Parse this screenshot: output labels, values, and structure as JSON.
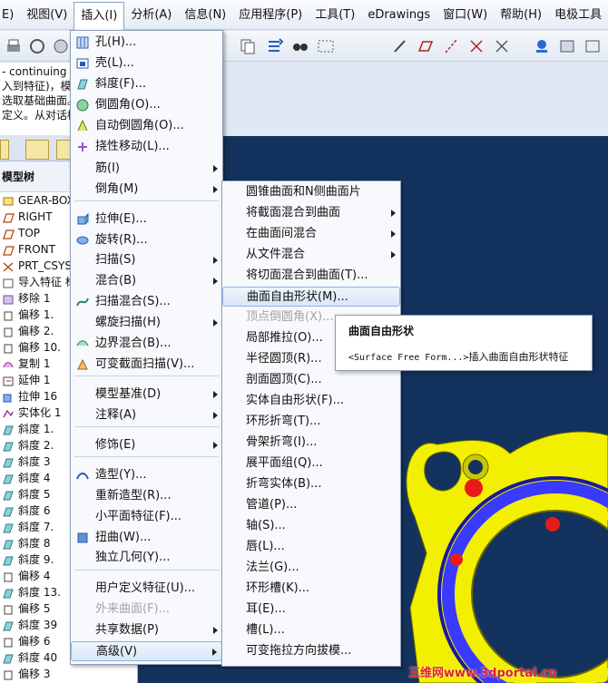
{
  "menubar": {
    "items": [
      {
        "label": "E)"
      },
      {
        "label": "视图(V)"
      },
      {
        "label": "插入(I)"
      },
      {
        "label": "分析(A)"
      },
      {
        "label": "信息(N)"
      },
      {
        "label": "应用程序(P)"
      },
      {
        "label": "工具(T)"
      },
      {
        "label": "eDrawings"
      },
      {
        "label": "窗口(W)"
      },
      {
        "label": "帮助(H)"
      },
      {
        "label": "电极工具"
      }
    ]
  },
  "message_area": {
    "lines": [
      "- continuing fro",
      "入到特征)，模型",
      "选取基础曲面。",
      "定义。从对话框"
    ]
  },
  "model_tree": {
    "header": "模型树",
    "items": [
      {
        "label": "GEAR-BOX.PRT",
        "icon": "part-icon"
      },
      {
        "label": "RIGHT",
        "icon": "datum-plane-icon"
      },
      {
        "label": "TOP",
        "icon": "datum-plane-icon"
      },
      {
        "label": "FRONT",
        "icon": "datum-plane-icon"
      },
      {
        "label": "PRT_CSYS_",
        "icon": "csys-icon"
      },
      {
        "label": "导入特征 标",
        "icon": "import-icon"
      },
      {
        "label": "移除 1",
        "icon": "remove-icon"
      },
      {
        "label": "偏移 1.",
        "icon": "offset-icon"
      },
      {
        "label": "偏移 2.",
        "icon": "offset-icon"
      },
      {
        "label": "偏移 10.",
        "icon": "offset-icon"
      },
      {
        "label": "复制 1",
        "icon": "copy-icon"
      },
      {
        "label": "延伸 1",
        "icon": "extend-icon"
      },
      {
        "label": "拉伸 16",
        "icon": "extrude-icon"
      },
      {
        "label": "实体化 1",
        "icon": "solidify-icon"
      },
      {
        "label": "斜度 1.",
        "icon": "draft-icon"
      },
      {
        "label": "斜度 2.",
        "icon": "draft-icon"
      },
      {
        "label": "斜度 3",
        "icon": "draft-icon"
      },
      {
        "label": "斜度 4",
        "icon": "draft-icon"
      },
      {
        "label": "斜度 5",
        "icon": "draft-icon"
      },
      {
        "label": "斜度 6",
        "icon": "draft-icon"
      },
      {
        "label": "斜度 7.",
        "icon": "draft-icon"
      },
      {
        "label": "斜度 8",
        "icon": "draft-icon"
      },
      {
        "label": "斜度 9.",
        "icon": "draft-icon"
      },
      {
        "label": "偏移 4",
        "icon": "offset-icon"
      },
      {
        "label": "斜度 13.",
        "icon": "draft-icon"
      },
      {
        "label": "偏移 5",
        "icon": "offset-icon"
      },
      {
        "label": "斜度 39",
        "icon": "draft-icon"
      },
      {
        "label": "偏移 6",
        "icon": "offset-icon"
      },
      {
        "label": "斜度 40",
        "icon": "draft-icon"
      },
      {
        "label": "偏移 3",
        "icon": "offset-icon"
      }
    ]
  },
  "insert_menu": {
    "items": [
      {
        "label": "孔(H)...",
        "icon": "hole-icon"
      },
      {
        "label": "壳(L)...",
        "icon": "shell-icon"
      },
      {
        "label": "斜度(F)...",
        "icon": "draft-icon"
      },
      {
        "label": "倒圆角(O)...",
        "icon": "round-icon"
      },
      {
        "label": "自动倒圆角(O)...",
        "icon": "auto-round-icon"
      },
      {
        "label": "挠性移动(L)...",
        "icon": "flexible-move-icon"
      },
      {
        "label": "筋(I)",
        "submenu": true
      },
      {
        "label": "倒角(M)",
        "submenu": true
      },
      {
        "label": "拉伸(E)...",
        "icon": "extrude-icon"
      },
      {
        "label": "旋转(R)...",
        "icon": "revolve-icon"
      },
      {
        "label": "扫描(S)",
        "submenu": true
      },
      {
        "label": "混合(B)",
        "submenu": true
      },
      {
        "label": "扫描混合(S)...",
        "icon": "swept-blend-icon"
      },
      {
        "label": "螺旋扫描(H)",
        "submenu": true
      },
      {
        "label": "边界混合(B)...",
        "icon": "boundary-blend-icon"
      },
      {
        "label": "可变截面扫描(V)...",
        "icon": "variable-sweep-icon"
      },
      {
        "label": "模型基准(D)",
        "submenu": true
      },
      {
        "label": "注释(A)",
        "submenu": true
      },
      {
        "label": "修饰(E)",
        "submenu": true
      },
      {
        "label": "造型(Y)...",
        "icon": "style-icon"
      },
      {
        "label": "重新造型(R)..."
      },
      {
        "label": "小平面特征(F)..."
      },
      {
        "label": "扭曲(W)...",
        "icon": "warp-icon"
      },
      {
        "label": "独立几何(Y)..."
      },
      {
        "label": "用户定义特征(U)..."
      },
      {
        "label": "外来曲面(F)...",
        "disabled": true
      },
      {
        "label": "共享数据(P)",
        "submenu": true
      },
      {
        "label": "高级(V)",
        "submenu": true,
        "highlighted": true
      }
    ]
  },
  "advanced_menu": {
    "items": [
      {
        "label": "圆锥曲面和N侧曲面片"
      },
      {
        "label": "将截面混合到曲面",
        "submenu": true
      },
      {
        "label": "在曲面间混合",
        "submenu": true
      },
      {
        "label": "从文件混合",
        "submenu": true
      },
      {
        "label": "将切面混合到曲面(T)..."
      },
      {
        "label": "曲面自由形状(M)...",
        "highlighted": true
      },
      {
        "label": "顶点倒圆角(X)...",
        "disabled": true
      },
      {
        "label": "局部推拉(O)..."
      },
      {
        "label": "半径圆顶(R)..."
      },
      {
        "label": "剖面圆顶(C)..."
      },
      {
        "label": "实体自由形状(F)..."
      },
      {
        "label": "环形折弯(T)..."
      },
      {
        "label": "骨架折弯(I)..."
      },
      {
        "label": "展平面组(Q)..."
      },
      {
        "label": "折弯实体(B)..."
      },
      {
        "label": "管道(P)..."
      },
      {
        "label": "轴(S)..."
      },
      {
        "label": "唇(L)..."
      },
      {
        "label": "法兰(G)..."
      },
      {
        "label": "环形槽(K)..."
      },
      {
        "label": "耳(E)..."
      },
      {
        "label": "槽(L)..."
      },
      {
        "label": "可变拖拉方向拔模..."
      }
    ]
  },
  "tooltip": {
    "title": "曲面自由形状",
    "body_prefix": "<Surface Free Form...>",
    "body_text": "插入曲面自由形状特征"
  },
  "watermark": "三维网www.3dportal.cn",
  "colors": {
    "viewport_bg": "#14325e",
    "part_yellow": "#f2f000",
    "ring_blue": "#3a3aff",
    "point_red": "#e81b1b",
    "highlight_border": "#8db2e3"
  }
}
